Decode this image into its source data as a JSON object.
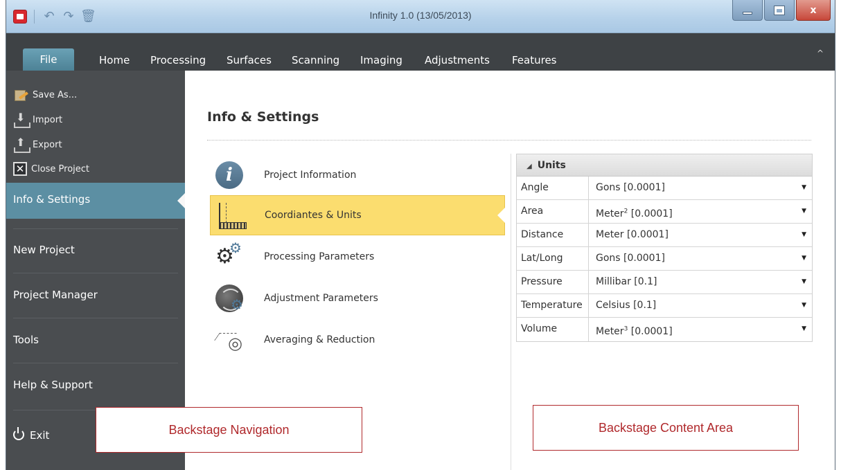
{
  "window": {
    "title": "Infinity 1.0 (13/05/2013)",
    "quick_access": [
      "undo-icon",
      "redo-icon",
      "trash-icon"
    ],
    "controls": {
      "minimize": "",
      "maximize": "",
      "close": "x"
    }
  },
  "ribbon": {
    "tabs": [
      "File",
      "Home",
      "Processing",
      "Surfaces",
      "Scanning",
      "Imaging",
      "Adjustments",
      "Features"
    ],
    "active_tab": "File",
    "collapse_icon": "^"
  },
  "backstage_nav": {
    "small_items": [
      {
        "label": "Save As...",
        "icon": "save-as-icon"
      },
      {
        "label": "Import",
        "icon": "import-icon"
      },
      {
        "label": "Export",
        "icon": "export-icon"
      },
      {
        "label": "Close Project",
        "icon": "close-project-icon"
      }
    ],
    "selected": "Info & Settings",
    "big_items": [
      "New Project",
      "Project Manager",
      "Tools",
      "Help & Support"
    ],
    "exit": "Exit"
  },
  "content": {
    "title": "Info & Settings",
    "categories": [
      {
        "label": "Project Information",
        "icon": "info-icon"
      },
      {
        "label": "Coordiantes & Units",
        "icon": "coordinates-ruler-icon",
        "selected": true
      },
      {
        "label": "Processing Parameters",
        "icon": "gears-icon"
      },
      {
        "label": "Adjustment Parameters",
        "icon": "globe-gear-icon"
      },
      {
        "label": "Averaging & Reduction",
        "icon": "averaging-icon"
      }
    ],
    "units": {
      "header": "Units",
      "rows": [
        {
          "name": "Angle",
          "value": "Gons [0.0001]"
        },
        {
          "name": "Area",
          "value_pre": "Meter",
          "value_sup": "2",
          "value_post": " [0.0001]"
        },
        {
          "name": "Distance",
          "value": "Meter [0.0001]"
        },
        {
          "name": "Lat/Long",
          "value": "Gons [0.0001]"
        },
        {
          "name": "Pressure",
          "value": "Millibar [0.1]"
        },
        {
          "name": "Temperature",
          "value": "Celsius [0.1]"
        },
        {
          "name": "Volume",
          "value_pre": "Meter",
          "value_sup": "3",
          "value_post": " [0.0001]"
        }
      ]
    }
  },
  "annotations": {
    "left": "Backstage Navigation",
    "right": "Backstage Content Area"
  },
  "colors": {
    "nav_bg": "#4a4d50",
    "nav_selected": "#5c8fa3",
    "category_selected": "#fbdd6f",
    "annotation": "#b0292c"
  }
}
